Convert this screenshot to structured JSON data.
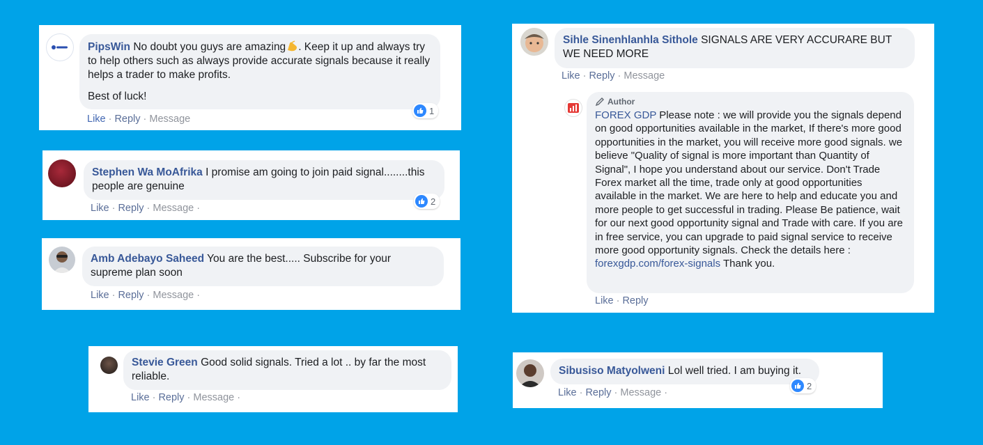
{
  "comments": [
    {
      "name": "PipsWin",
      "text_part1": "No doubt you guys are amazing",
      "text_part2": ". Keep it up and always try to help others such as always provide accurate signals because it really helps a trader to make profits.",
      "text_line2": "Best of luck!",
      "like": "Like",
      "reply": "Reply",
      "message": "Message",
      "reactions": "1"
    },
    {
      "name": "Stephen Wa MoAfrika",
      "text": "I promise am going to join paid signal........this people are genuine",
      "like": "Like",
      "reply": "Reply",
      "message": "Message",
      "reactions": "2"
    },
    {
      "name": "Amb Adebayo Saheed",
      "text": "You are the best..... Subscribe for your supreme plan soon",
      "like": "Like",
      "reply": "Reply",
      "message": "Message"
    },
    {
      "name": "Stevie Green",
      "text": "Good solid signals. Tried a lot .. by far the most reliable.",
      "like": "Like",
      "reply": "Reply",
      "message": "Message"
    },
    {
      "name": "Sihle Sinenhlanhla Sithole",
      "text": "SIGNALS ARE VERY ACCURARE BUT WE NEED MORE",
      "like": "Like",
      "reply": "Reply",
      "message": "Message",
      "reply_comment": {
        "badge": "Author",
        "name": "FOREX GDP",
        "text": "Please note : we will provide you the signals depend on good opportunities available in the market, If there's more good opportunities in the market, you will receive more good signals. we believe \"Quality of signal is more important than Quantity of Signal\", I hope you understand about our service. Don't Trade Forex market all the time, trade only at good opportunities available in the market. We are here to help and educate you and more people to get successful in trading. Please Be patience, wait for our next good opportunity signal and Trade with care. If you are in free service, you can upgrade to paid signal service to receive more good opportunity signals. Check the details here :",
        "link": "forexgdp.com/forex-signals",
        "text_end": "Thank you.",
        "like": "Like",
        "reply": "Reply"
      }
    },
    {
      "name": "Sibusiso Matyolweni",
      "text": "Lol well tried. I am buying it.",
      "like": "Like",
      "reply": "Reply",
      "message": "Message",
      "reactions": "2"
    }
  ],
  "colors": {
    "background": "#00a3e8",
    "name": "#385898",
    "bubble": "#f0f2f5",
    "like_reaction": "#2d88ff"
  },
  "icons": [
    "pipswin-logo-avatar",
    "user-avatar",
    "like-reaction-icon",
    "pencil-icon",
    "forex-gdp-logo-avatar",
    "clapping-hands-emoji"
  ]
}
